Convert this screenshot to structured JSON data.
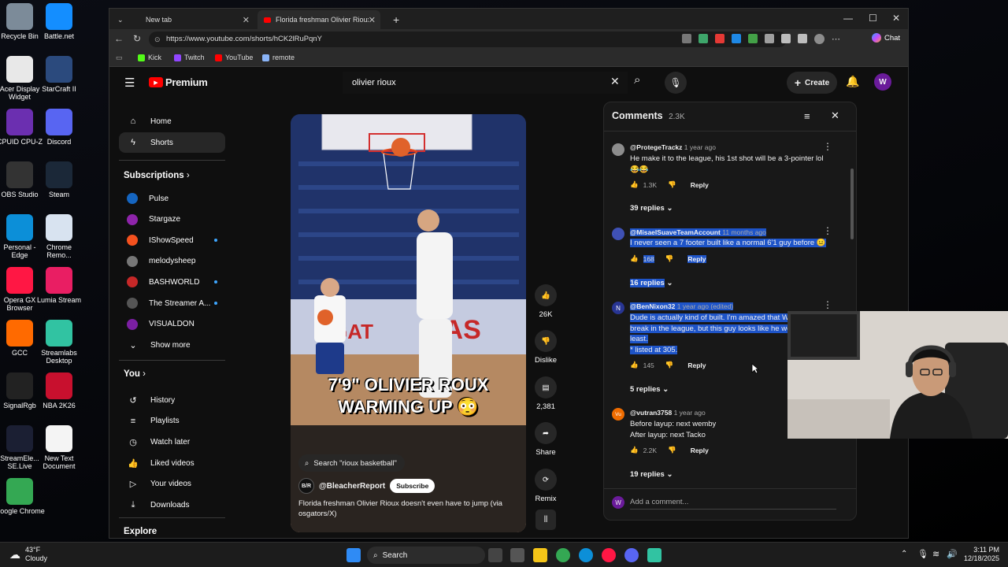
{
  "desktop": {
    "icons": [
      {
        "label": "Recycle Bin",
        "color": "#7c8b99"
      },
      {
        "label": "Battle.net",
        "color": "#148eff"
      },
      {
        "label": "Acer Display Widget",
        "color": "#e8e8e8"
      },
      {
        "label": "StarCraft II",
        "color": "#2b4a7d"
      },
      {
        "label": "CPUID CPU-Z",
        "color": "#6b2fb0"
      },
      {
        "label": "Discord",
        "color": "#5865f2"
      },
      {
        "label": "OBS Studio",
        "color": "#333333"
      },
      {
        "label": "Steam",
        "color": "#1b2838"
      },
      {
        "label": "Personal - Edge",
        "color": "#0c8fd8"
      },
      {
        "label": "Chrome Remo...",
        "color": "#d8e3f0"
      },
      {
        "label": "Opera GX Browser",
        "color": "#ff1744"
      },
      {
        "label": "Lumia Stream",
        "color": "#e91e63"
      },
      {
        "label": "GCC",
        "color": "#ff6a00"
      },
      {
        "label": "Streamlabs Desktop",
        "color": "#31c3a2"
      },
      {
        "label": "SignalRgb",
        "color": "#222222"
      },
      {
        "label": "NBA 2K26",
        "color": "#c8102e"
      },
      {
        "label": "StreamEle... SE.Live",
        "color": "#1b1f33"
      },
      {
        "label": "New Text Document",
        "color": "#f4f4f4"
      },
      {
        "label": "Google Chrome",
        "color": "#34a853"
      }
    ]
  },
  "browser": {
    "tabs": [
      {
        "label": "New tab"
      },
      {
        "label": "Florida freshman Olivier Rioux"
      }
    ],
    "url": "https://www.youtube.com/shorts/hCK2lRuPqnY",
    "chat_label": "Chat",
    "bookmarks": [
      {
        "label": "Kick",
        "color": "#53fc18"
      },
      {
        "label": "Twitch",
        "color": "#9146ff"
      },
      {
        "label": "YouTube",
        "color": "#ff0000"
      },
      {
        "label": "remote",
        "color": "#8ab4f8"
      }
    ]
  },
  "youtube": {
    "logo_text": "Premium",
    "search_value": "olivier rioux",
    "create_label": "Create",
    "user_initial": "W",
    "sidebar": {
      "main": [
        {
          "label": "Home",
          "icon": "⌂"
        },
        {
          "label": "Shorts",
          "icon": "ϟ"
        }
      ],
      "subscriptions_title": "Subscriptions",
      "subscriptions": [
        {
          "label": "Pulse",
          "color": "#1565c0",
          "dot": false
        },
        {
          "label": "Stargaze",
          "color": "#8e24aa",
          "dot": false
        },
        {
          "label": "IShowSpeed",
          "color": "#f4511e",
          "dot": true
        },
        {
          "label": "melodysheep",
          "color": "#777777",
          "dot": false
        },
        {
          "label": "BASHWORLD",
          "color": "#c62828",
          "dot": true
        },
        {
          "label": "The Streamer A...",
          "color": "#555555",
          "dot": true
        },
        {
          "label": "VISUALDON",
          "color": "#7b1fa2",
          "dot": false
        }
      ],
      "show_more": "Show more",
      "you_title": "You",
      "you_items": [
        {
          "label": "History",
          "icon": "↺"
        },
        {
          "label": "Playlists",
          "icon": "≡"
        },
        {
          "label": "Watch later",
          "icon": "◷"
        },
        {
          "label": "Liked videos",
          "icon": "👍"
        },
        {
          "label": "Your videos",
          "icon": "▷"
        },
        {
          "label": "Downloads",
          "icon": "⤓"
        }
      ],
      "explore_title": "Explore"
    },
    "short": {
      "overlay_text_line1": "7'9\" OLIVIER ROUX",
      "overlay_text_line2": "WARMING UP 😳",
      "search_chip": "Search \"rioux basketball\"",
      "channel": "@BleacherReport",
      "channel_initials": "B/R",
      "subscribe_label": "Subscribe",
      "title": "Florida freshman Olivier Rioux doesn't even have to jump (via osgators/X)"
    },
    "actions": [
      {
        "name": "like",
        "label": "26K",
        "glyph": "👍"
      },
      {
        "name": "dislike",
        "label": "Dislike",
        "glyph": "👎"
      },
      {
        "name": "comments",
        "label": "2,381",
        "glyph": "▤"
      },
      {
        "name": "share",
        "label": "Share",
        "glyph": "➦"
      },
      {
        "name": "remix",
        "label": "Remix",
        "glyph": "⟳"
      }
    ],
    "comments": {
      "title": "Comments",
      "count": "2.3K",
      "add_placeholder": "Add a comment...",
      "items": [
        {
          "user": "@ProtegeTrackz",
          "time": "1 year ago",
          "text": "He make it to the league, his 1st shot will be a 3-pointer lol 😂😂",
          "likes": "1.3K",
          "replies": "39 replies",
          "avatar_color": "#8d8d8d",
          "avatar_initial": ""
        },
        {
          "user": "@MisaelSuaveTeamAccount",
          "time": "11 months ago",
          "text": "I never seen a 7 footer built like a normal 6'1 guy before 😐",
          "likes": "168",
          "replies": "16 replies",
          "avatar_color": "#3f51b5",
          "avatar_initial": ""
        },
        {
          "user": "@BenNixon32",
          "time": "1 year ago (edited)",
          "text_lines": [
            "Dude is actually kind of built. I'm amazed that W",
            "break in the league, but this guy looks like he we",
            "least.",
            "* listed at 305."
          ],
          "likes": "145",
          "replies": "5 replies",
          "avatar_color": "#283593",
          "avatar_initial": "N"
        },
        {
          "user": "@vutran3758",
          "time": "1 year ago",
          "text_lines": [
            "Before layup: next wemby",
            "After layup: next Tacko"
          ],
          "likes": "2.2K",
          "replies": "19 replies",
          "avatar_color": "#ef6c00",
          "avatar_initial": "Vu"
        }
      ],
      "reply_label": "Reply"
    }
  },
  "taskbar": {
    "weather_temp": "43°F",
    "weather_desc": "Cloudy",
    "search_label": "Search",
    "time": "3:11 PM",
    "date": "12/18/2025"
  }
}
